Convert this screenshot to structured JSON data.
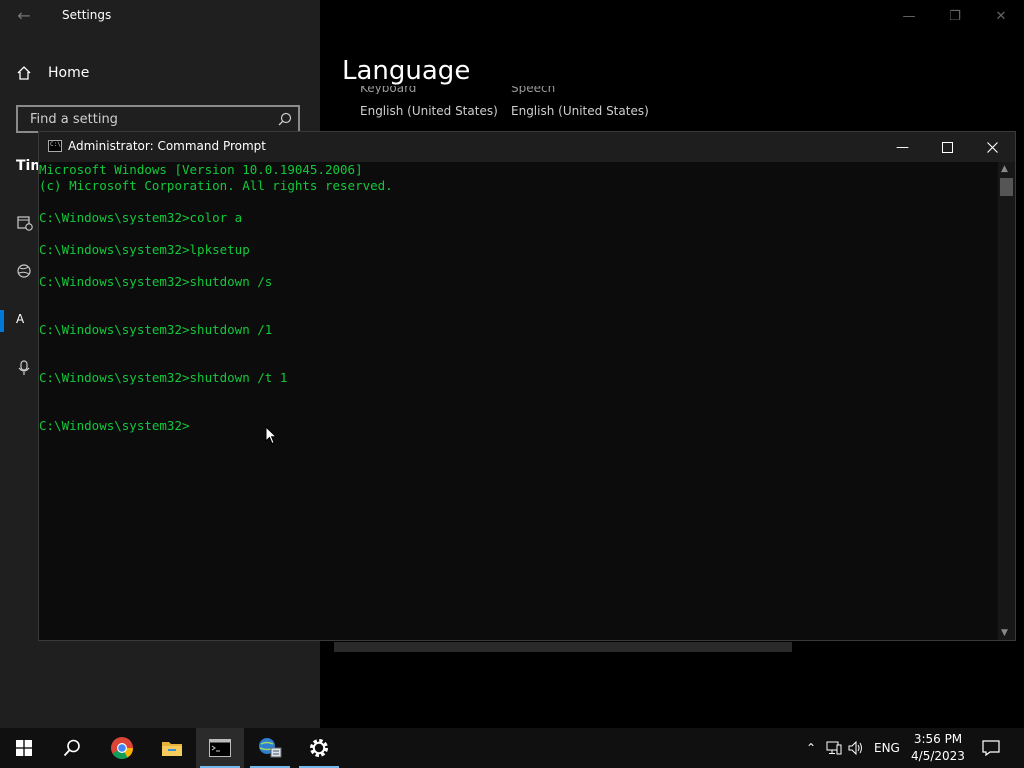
{
  "settings": {
    "title": "Settings",
    "home_label": "Home",
    "search_placeholder": "Find a setting",
    "partial_section": "Tim",
    "partial_lang_item": "A",
    "page_heading": "Language",
    "keyboard_label": "Keyboard",
    "keyboard_value": "English (United States)",
    "speech_label": "Speech",
    "speech_value": "English (United States)"
  },
  "cmd": {
    "title": "Administrator: Command Prompt",
    "icon_text": "C:\\",
    "lines": [
      "Microsoft Windows [Version 10.0.19045.2006]",
      "(c) Microsoft Corporation. All rights reserved.",
      "",
      "C:\\Windows\\system32>color a",
      "",
      "C:\\Windows\\system32>lpksetup",
      "",
      "C:\\Windows\\system32>shutdown /s",
      "",
      "",
      "C:\\Windows\\system32>shutdown /1",
      "",
      "",
      "C:\\Windows\\system32>shutdown /t 1",
      "",
      "",
      "C:\\Windows\\system32>"
    ],
    "text_color": "#13c83a"
  },
  "taskbar": {
    "apps": [
      "start-icon",
      "search-icon",
      "chrome-icon",
      "file-explorer-icon",
      "command-prompt-icon",
      "network-app-icon",
      "settings-icon"
    ],
    "language": "ENG",
    "time": "3:56 PM",
    "date": "4/5/2023"
  }
}
